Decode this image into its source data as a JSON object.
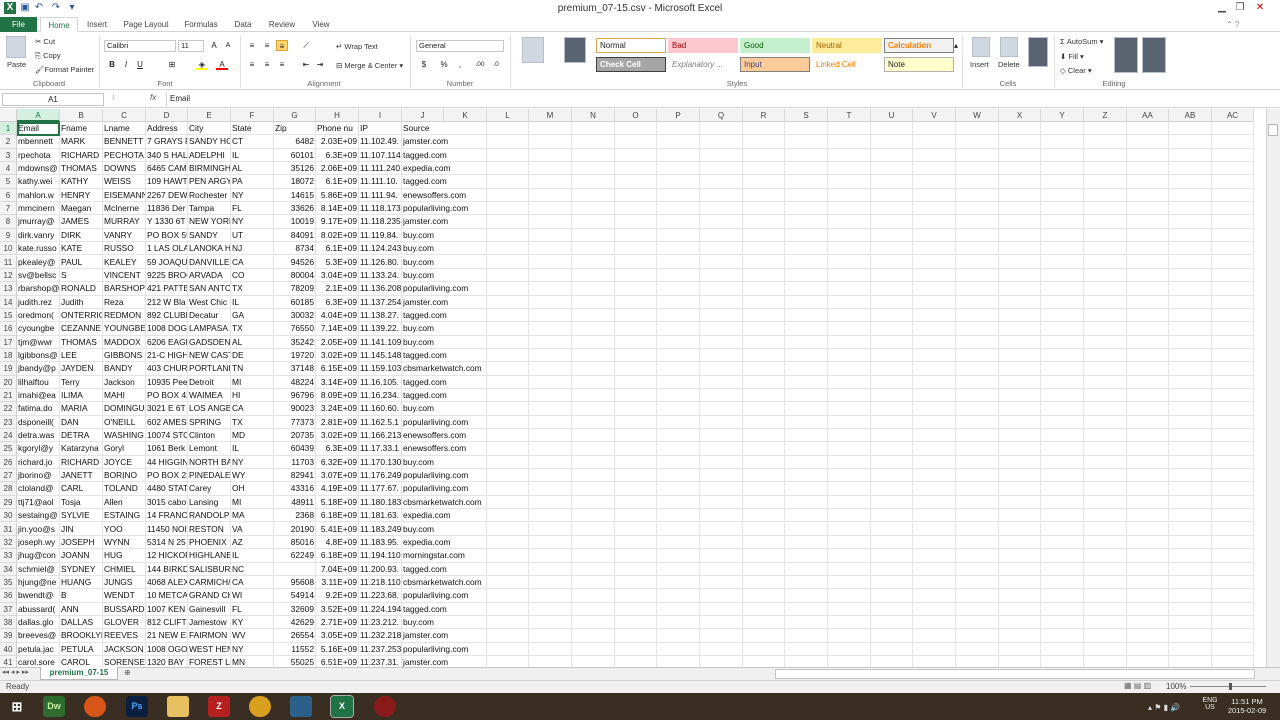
{
  "window": {
    "title": "premium_07-15.csv - Microsoft Excel"
  },
  "tabs": [
    "Home",
    "Insert",
    "Page Layout",
    "Formulas",
    "Data",
    "Review",
    "View"
  ],
  "file_tab": "File",
  "ribbon": {
    "clipboard": {
      "paste": "Paste",
      "cut": "Cut",
      "copy": "Copy",
      "format_painter": "Format Painter",
      "label": "Clipboard"
    },
    "font": {
      "name": "Calibri",
      "size": "11",
      "label": "Font",
      "bold": "B",
      "italic": "I",
      "underline": "U"
    },
    "alignment": {
      "wrap": "Wrap Text",
      "merge": "Merge & Center",
      "label": "Alignment"
    },
    "number": {
      "format": "General",
      "currency": "$",
      "percent": "%",
      "comma": ",",
      "label": "Number"
    },
    "styles": {
      "conditional": "Conditional Formatting",
      "format_table": "Format as Table",
      "boxes": [
        {
          "text": "Normal",
          "bg": "#ffffff",
          "fg": "#222222",
          "border": "#d9a54a"
        },
        {
          "text": "Bad",
          "bg": "#ffc7ce",
          "fg": "#9c0006",
          "border": "#ffc7ce"
        },
        {
          "text": "Good",
          "bg": "#c6efce",
          "fg": "#006100",
          "border": "#c6efce"
        },
        {
          "text": "Neutral",
          "bg": "#ffeb9c",
          "fg": "#9c6500",
          "border": "#ffeb9c"
        },
        {
          "text": "Calculation",
          "bg": "#f2f2f2",
          "fg": "#fa7d00",
          "border": "#7f7f7f"
        },
        {
          "text": "Check Cell",
          "bg": "#a5a5a5",
          "fg": "#ffffff",
          "border": "#3f3f3f"
        },
        {
          "text": "Explanatory ...",
          "bg": "#ffffff",
          "fg": "#7f7f7f",
          "border": "#ffffff"
        },
        {
          "text": "Input",
          "bg": "#ffcc99",
          "fg": "#3f3f76",
          "border": "#7f7f7f"
        },
        {
          "text": "Linked Cell",
          "bg": "#ffffff",
          "fg": "#fa7d00",
          "border": "#ffffff"
        },
        {
          "text": "Note",
          "bg": "#ffffcc",
          "fg": "#222222",
          "border": "#b2b2b2"
        }
      ],
      "label": "Styles"
    },
    "cells": {
      "insert": "Insert",
      "delete": "Delete",
      "format": "Format",
      "label": "Cells"
    },
    "editing": {
      "autosum": "AutoSum",
      "fill": "Fill",
      "clear": "Clear",
      "sort": "Sort & Filter",
      "find": "Find & Select",
      "label": "Editing"
    }
  },
  "formula_bar": {
    "name_box": "A1",
    "fx": "fx",
    "content": "Email"
  },
  "columns": [
    "A",
    "B",
    "C",
    "D",
    "E",
    "F",
    "G",
    "H",
    "I",
    "J",
    "K",
    "L",
    "M",
    "N",
    "O",
    "P",
    "Q",
    "R",
    "S",
    "T",
    "U",
    "V",
    "W",
    "X",
    "Y",
    "Z",
    "AA",
    "AB",
    "AC"
  ],
  "rows": [
    [
      "Email",
      "Fname",
      "Lname",
      "Address",
      "City",
      "State",
      "Zip",
      "Phone nu",
      "IP",
      "Source"
    ],
    [
      "mbennett",
      "MARK",
      "BENNETT",
      "7 GRAYS P",
      "SANDY HC",
      "CT",
      "6482",
      "2.03E+09",
      "11.102.49.",
      "jamster.com"
    ],
    [
      "rpechota",
      "RICHARD",
      "PECHOTA",
      "340 S HAL",
      "ADELPHI",
      "IL",
      "60101",
      "6.3E+09",
      "11.107.114",
      "tagged.com"
    ],
    [
      "mdowns@",
      "THOMAS",
      "DOWNS",
      "6465 CAM",
      "BIRMINGH",
      "AL",
      "35126",
      "2.06E+09",
      "11.111.240",
      "expedia.com"
    ],
    [
      "kathy.wei",
      "KATHY",
      "WEISS",
      "109 HAWT",
      "PEN ARGY",
      "PA",
      "18072",
      "6.1E+09",
      "11.111.10.",
      "tagged.com"
    ],
    [
      "mahlon.w",
      "HENRY",
      "EISEMANN",
      "2267 DEW",
      "Rochester",
      "NY",
      "14615",
      "5.86E+09",
      "11.111.94.",
      "enewsoffers.com"
    ],
    [
      "mmcinern",
      "Maegan",
      "McInerne",
      "11836 Der",
      "Tampa",
      "FL",
      "33626",
      "8.14E+09",
      "11.118.173",
      "popularliving.com"
    ],
    [
      "jmurray@",
      "JAMES",
      "MURRAY",
      "Y   1330 6T",
      "NEW YORI",
      "NY",
      "10019",
      "9.17E+09",
      "11.118.235",
      "jamster.com"
    ],
    [
      "dirk.vanry",
      "DIRK",
      "VANRY",
      "PO BOX 59",
      "SANDY",
      "UT",
      "84091",
      "8.02E+09",
      "11.119.84.",
      "buy.com"
    ],
    [
      "kate.russo",
      "KATE",
      "RUSSO",
      "1 LAS OLA",
      "LANOKA H",
      "NJ",
      "8734",
      "6.1E+09",
      "11.124.243",
      "buy.com"
    ],
    [
      "pkealey@",
      "PAUL",
      "KEALEY",
      "59 JOAQU",
      "DANVILLE",
      "CA",
      "94526",
      "5.3E+09",
      "11.126.80.",
      "buy.com"
    ],
    [
      "sv@bellsc",
      "S",
      "VINCENT",
      "9225 BROC",
      "ARVADA",
      "CO",
      "80004",
      "3.04E+09",
      "11.133.24.",
      "buy.com"
    ],
    [
      "rbarshop@",
      "RONALD",
      "BARSHOP",
      "421 PATTE",
      "SAN ANTC",
      "TX",
      "78209",
      "2.1E+09",
      "11.136.208",
      "popularliving.com"
    ],
    [
      "judith.rez",
      "Judith",
      "Reza",
      "212 W Bla",
      "West Chic",
      "IL",
      "60185",
      "6.3E+09",
      "11.137.254",
      "jamster.com"
    ],
    [
      "oredmon(",
      "ONTERRIO",
      "REDMON",
      "892 CLUBH",
      "Decatur",
      "GA",
      "30032",
      "4.04E+09",
      "11.138.27.",
      "tagged.com"
    ],
    [
      "cyoungbe",
      "CEZANNE",
      "YOUNGBE",
      "1008 DOG",
      "LAMPASA",
      "TX",
      "76550",
      "7.14E+09",
      "11.139.22.",
      "buy.com"
    ],
    [
      "tjm@wwr",
      "THOMAS",
      "MADDOX",
      "6206 EAGL",
      "GADSDEN",
      "AL",
      "35242",
      "2.05E+09",
      "11.141.109",
      "buy.com"
    ],
    [
      "lgibbons@",
      "LEE",
      "GIBBONS",
      "21-C HIGH",
      "NEW CAST",
      "DE",
      "19720",
      "3.02E+09",
      "11.145.148",
      "tagged.com"
    ],
    [
      "jbandy@p",
      "JAYDEN",
      "BANDY",
      "403 CHUR",
      "PORTLANI",
      "TN",
      "37148",
      "6.15E+09",
      "11.159.103",
      "cbsmarketwatch.com"
    ],
    [
      "lilhalftou",
      "Terry",
      "Jackson",
      "10935 Pee",
      "Detroit",
      "MI",
      "48224",
      "3.14E+09",
      "11.16.105.",
      "tagged.com"
    ],
    [
      "imahi@ea",
      "ILIMA",
      "MAHI",
      "PO BOX 42",
      "WAIMEA",
      "HI",
      "96796",
      "8.09E+09",
      "11.16.234.",
      "tagged.com"
    ],
    [
      "fatima.do",
      "MARIA",
      "DOMINGU",
      "3021 E 6T",
      "LOS ANGE",
      "CA",
      "90023",
      "3.24E+09",
      "11.160.60.",
      "buy.com"
    ],
    [
      "dsponeill(",
      "DAN",
      "O'NEILL",
      "602 AMES",
      "SPRING",
      "TX",
      "77373",
      "2.81E+09",
      "11.162.5.1",
      "popularliving.com"
    ],
    [
      "detra.was",
      "DETRA",
      "WASHING",
      "10074 STO",
      "Clinton",
      "MD",
      "20735",
      "3.02E+09",
      "11.166.213",
      "enewsoffers.com"
    ],
    [
      "kgoryl@y",
      "Katarzyna",
      "Goryl",
      "1061 Berk",
      "Lemont",
      "IL",
      "60439",
      "6.3E+09",
      "11.17.33.1",
      "enewsoffers.com"
    ],
    [
      "richard.jo",
      "RICHARD",
      "JOYCE",
      "44 HIGGIN",
      "NORTH BA",
      "NY",
      "11703",
      "6.32E+09",
      "11.170.130",
      "buy.com"
    ],
    [
      "jborino@",
      "JANETT",
      "BORINO",
      "PO BOX 23",
      "PINEDALE",
      "WY",
      "82941",
      "3.07E+09",
      "11.176.249",
      "popularliving.com"
    ],
    [
      "ctoland@",
      "CARL",
      "TOLAND",
      "4480 STAT",
      "Carey",
      "OH",
      "43316",
      "4.19E+09",
      "11.177.67.",
      "popularliving.com"
    ],
    [
      "ttj71@aol",
      "Tosja",
      "Allen",
      "3015 cabo",
      "Lansing",
      "MI",
      "48911",
      "5.18E+09",
      "11.180.183",
      "cbsmarketwatch.com"
    ],
    [
      "sestaing@",
      "SYLVIE",
      "ESTAING",
      "14 FRANCI",
      "RANDOLP",
      "MA",
      "2368",
      "6.18E+09",
      "11.181.63.",
      "expedia.com"
    ],
    [
      "jin.yoo@s",
      "JIN",
      "YOO",
      "11450 NOI",
      "RESTON",
      "VA",
      "20190",
      "5.41E+09",
      "11.183.249",
      "buy.com"
    ],
    [
      "joseph.wy",
      "JOSEPH",
      "WYNN",
      "5314 N 25",
      "PHOENIX",
      "AZ",
      "85016",
      "4.8E+09",
      "11.183.95.",
      "expedia.com"
    ],
    [
      "jhug@con",
      "JOANN",
      "HUG",
      "12 HICKOF",
      "HIGHLANE",
      "IL",
      "62249",
      "6.18E+09",
      "11.194.110",
      "morningstar.com"
    ],
    [
      "schmiel@",
      "SYDNEY",
      "CHMIEL",
      "144 BIRKD",
      "SALISBURY",
      "NC",
      "",
      "7.04E+09",
      "11.200.93.",
      "tagged.com"
    ],
    [
      "hjung@ne",
      "HUANG",
      "JUNGS",
      "4068 ALEX",
      "CARMICH/",
      "CA",
      "95608",
      "3.11E+09",
      "11.218.110",
      "cbsmarketwatch.com"
    ],
    [
      "bwendt@",
      "B",
      "WENDT",
      "10 METCA",
      "GRAND CH",
      "WI",
      "54914",
      "9.2E+09",
      "11.223.68.",
      "popularliving.com"
    ],
    [
      "abussard(",
      "ANN",
      "BUSSARD",
      "1007 KEN",
      "Gainesvill",
      "FL",
      "32609",
      "3.52E+09",
      "11.224.194",
      "tagged.com"
    ],
    [
      "dallas.glo",
      "DALLAS",
      "GLOVER",
      "812 CLIFT",
      "Jamestow",
      "KY",
      "42629",
      "2.71E+09",
      "11.23.212.",
      "buy.com"
    ],
    [
      "breeves@",
      "BROOKLYN",
      "REEVES",
      "21 NEW EI",
      "FAIRMON",
      "WV",
      "26554",
      "3.05E+09",
      "11.232.218",
      "jamster.com"
    ],
    [
      "petula.jac",
      "PETULA",
      "JACKSON",
      "1008 OGO",
      "WEST HEN",
      "NY",
      "11552",
      "5.16E+09",
      "11.237.253",
      "popularliving.com"
    ],
    [
      "carol.sore",
      "CAROL",
      "SORENSEN",
      "1320 BAY I",
      "FOREST LA",
      "MN",
      "55025",
      "6.51E+09",
      "11.237.31.",
      "jamster.com"
    ]
  ],
  "sheet_tab": "premium_07-15",
  "status": {
    "ready": "Ready",
    "zoom": "100%"
  },
  "taskbar": {
    "apps": [
      "Dw",
      "Ps"
    ],
    "lang": "ENG",
    "region": "US",
    "time": "11:51 PM",
    "date": "2015-02-09"
  }
}
